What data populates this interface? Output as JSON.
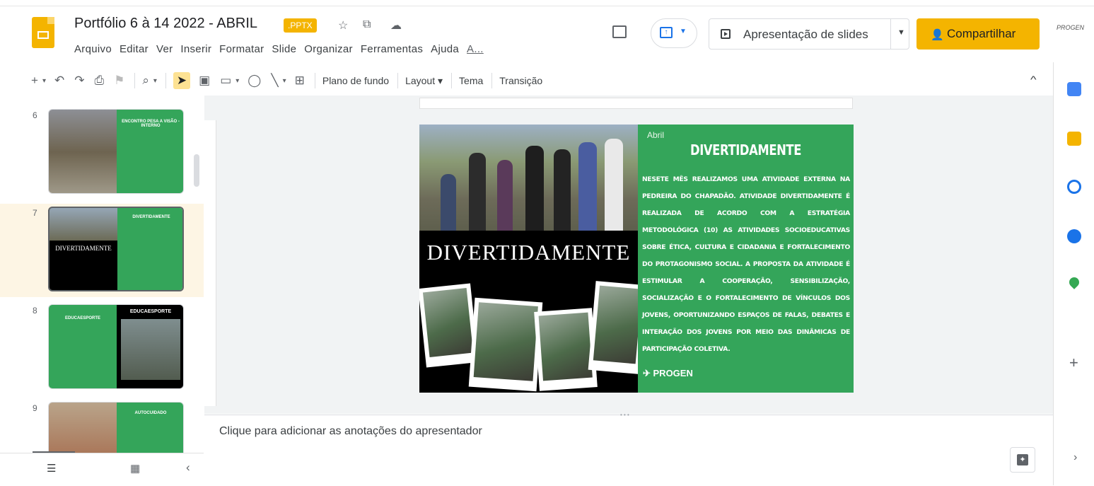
{
  "header": {
    "title": "Portfólio 6 à 14 2022 - ABRIL",
    "badge": ".PPTX",
    "menu": [
      "Arquivo",
      "Editar",
      "Ver",
      "Inserir",
      "Formatar",
      "Slide",
      "Organizar",
      "Ferramentas",
      "Ajuda",
      "A..."
    ],
    "slideshow_label": "Apresentação de slides",
    "share_label": "Compartilhar",
    "account_label": "PROGEN"
  },
  "toolbar": {
    "background": "Plano de fundo",
    "layout": "Layout",
    "theme": "Tema",
    "transition": "Transição"
  },
  "filmstrip": {
    "slides": [
      {
        "number": "6",
        "title": "ENCONTRO PESA A VISÃO -INTERNO"
      },
      {
        "number": "7",
        "title": "DIVERTIDAMENTE",
        "overlay": "DIVERTIDAMENTE"
      },
      {
        "number": "8",
        "title": "EDUCAESPORTE",
        "title2": "EDUCAESPORTE"
      },
      {
        "number": "9",
        "title": "AUTOCUIDADO"
      }
    ]
  },
  "slide": {
    "month": "Abril",
    "heading": "DIVERTIDAMENTE",
    "big_title": "DIVERTIDAMENTE",
    "body": "NESETE MÊS REALIZAMOS UMA ATIVIDADE EXTERNA NA PEDREIRA DO CHAPADÃO. ATIVIDADE DIVERTIDAMENTE É REALIZADA DE ACORDO COM A ESTRATÉGIA METODOLÓGICA (10) AS ATIVIDADES SOCIOEDUCATIVAS SOBRE ÉTICA, CULTURA E CIDADANIA E FORTALECIMENTO DO PROTAGONISMO SOCIAL. A PROPOSTA DA ATIVIDADE É ESTIMULAR A COOPERAÇÃO, SENSIBILIZAÇÃO, SOCIALIZAÇÃO E O FORTALECIMENTO DE VÍNCULOS DOS JOVENS, OPORTUNIZANDO ESPAÇOS DE FALAS, DEBATES E INTERAÇÃO DOS JOVENS POR MEIO DAS DINÂMICAS DE PARTICIPAÇÃO COLETIVA.",
    "logo": "PROGEN"
  },
  "notes": {
    "placeholder": "Clique para adicionar as anotações do apresentador"
  },
  "colors": {
    "accent": "#f4b400",
    "slide_green": "#34a55a",
    "selection": "#fdf5e4"
  }
}
